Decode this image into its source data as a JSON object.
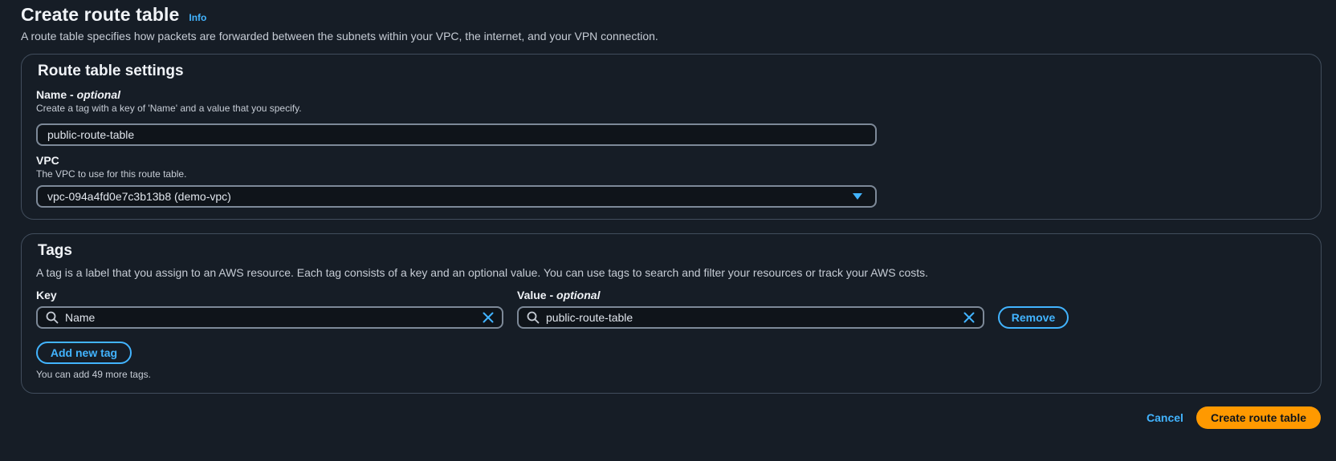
{
  "header": {
    "title": "Create route table",
    "info_label": "Info",
    "description": "A route table specifies how packets are forwarded between the subnets within your VPC, the internet, and your VPN connection."
  },
  "settings": {
    "title": "Route table settings",
    "name_label": "Name - ",
    "name_optional": "optional",
    "name_desc": "Create a tag with a key of 'Name' and a value that you specify.",
    "name_value": "public-route-table",
    "vpc_label": "VPC",
    "vpc_desc": "The VPC to use for this route table.",
    "vpc_value": "vpc-094a4fd0e7c3b13b8 (demo-vpc)"
  },
  "tags": {
    "title": "Tags",
    "description": "A tag is a label that you assign to an AWS resource. Each tag consists of a key and an optional value. You can use tags to search and filter your resources or track your AWS costs.",
    "key_label": "Key",
    "value_label": "Value - ",
    "value_optional": "optional",
    "rows": [
      {
        "key": "Name",
        "value": "public-route-table",
        "remove_label": "Remove"
      }
    ],
    "add_label": "Add new tag",
    "helper": "You can add 49 more tags."
  },
  "footer": {
    "cancel_label": "Cancel",
    "create_label": "Create route table"
  },
  "icons": {
    "search": "search-icon",
    "clear": "close-icon",
    "dropdown": "caret-down-icon"
  },
  "colors": {
    "background": "#161d26",
    "accent": "#42b4ff",
    "primary": "#ff9900",
    "border": "#414d5c"
  }
}
